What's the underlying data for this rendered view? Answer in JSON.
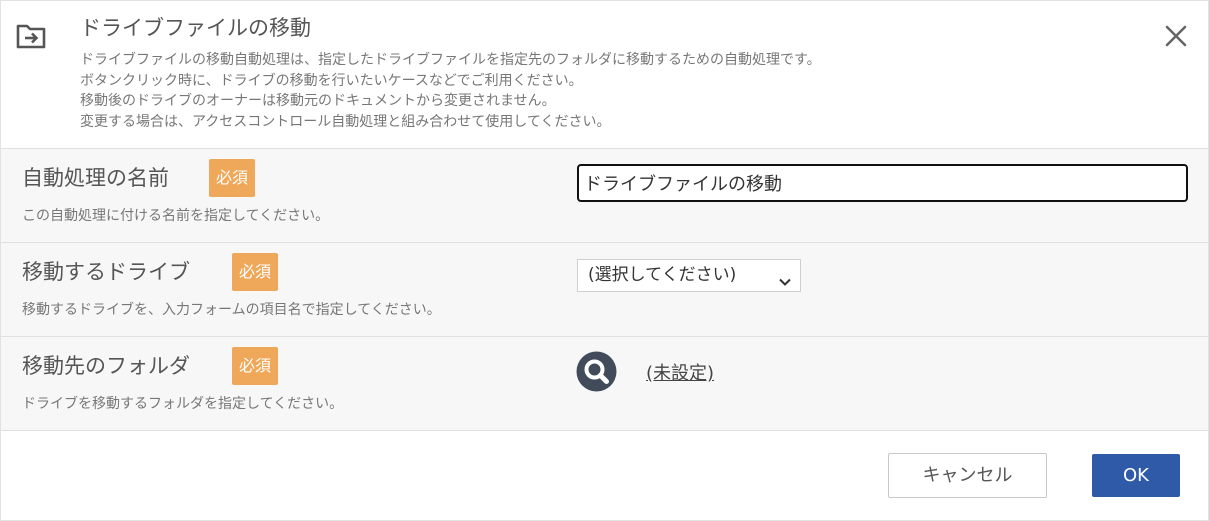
{
  "dialog": {
    "title": "ドライブファイルの移動",
    "header_icon": "folder-move-icon",
    "description": [
      "ドライブファイルの移動自動処理は、指定したドライブファイルを指定先のフォルダに移動するための自動処理です。",
      "ボタンクリック時に、ドライブの移動を行いたいケースなどでご利用ください。",
      "移動後のドライブのオーナーは移動元のドキュメントから変更されません。",
      "変更する場合は、アクセスコントロール自動処理と組み合わせて使用してください。"
    ],
    "close_icon": "close-icon"
  },
  "form": {
    "name_row": {
      "label": "自動処理の名前",
      "required_badge": "必須",
      "hint": "この自動処理に付ける名前を指定してください。",
      "value": "ドライブファイルの移動"
    },
    "drive_row": {
      "label": "移動するドライブ",
      "required_badge": "必須",
      "hint": "移動するドライブを、入力フォームの項目名で指定してください。",
      "selected": "(選択してください)"
    },
    "folder_row": {
      "label": "移動先のフォルダ",
      "required_badge": "必須",
      "hint": "ドライブを移動するフォルダを指定してください。",
      "search_icon": "search-icon",
      "value_link": "(未設定)"
    }
  },
  "footer": {
    "cancel_label": "キャンセル",
    "ok_label": "OK"
  },
  "colors": {
    "badge": "#efa85a",
    "primary": "#2f5aa8",
    "row_bg": "#f7f7f7",
    "search_icon_bg": "#414b5a"
  }
}
